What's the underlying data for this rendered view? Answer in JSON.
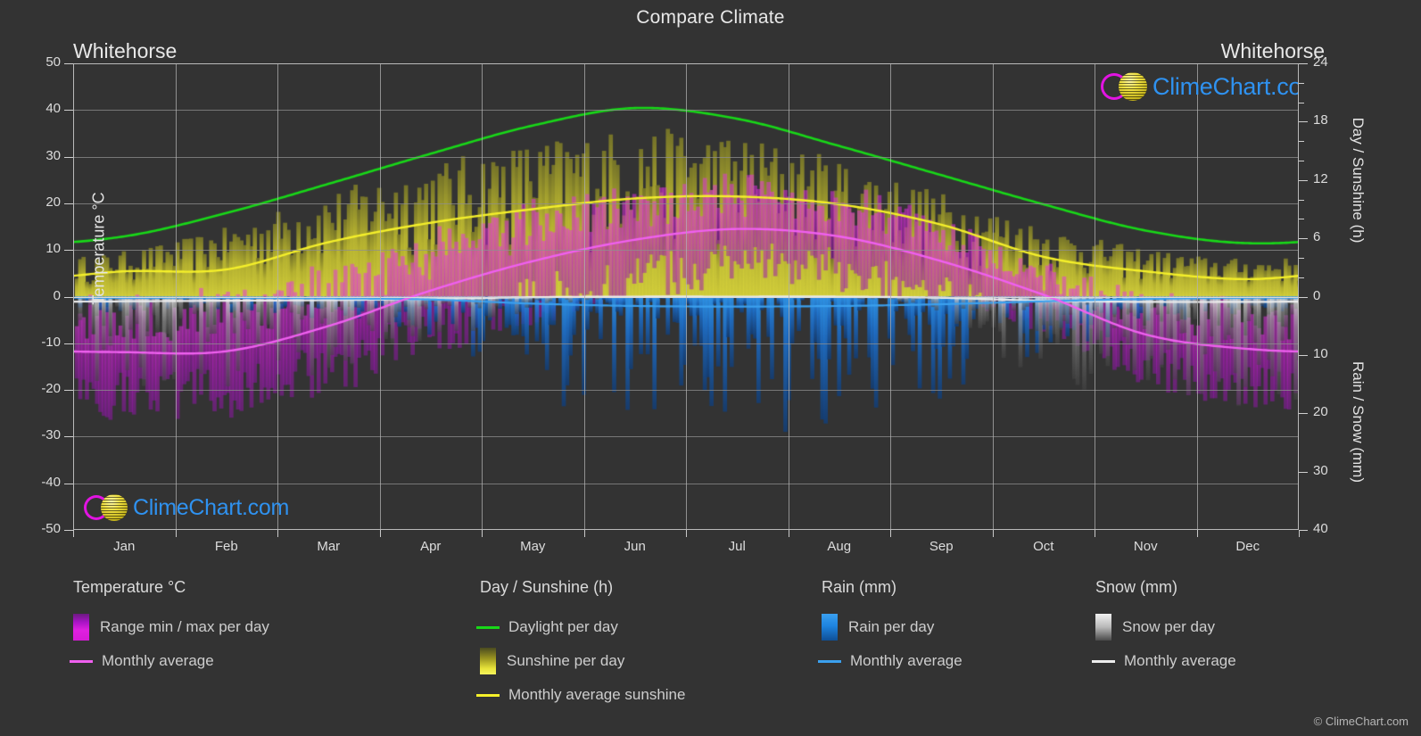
{
  "header": {
    "title": "Compare Climate",
    "location_left": "Whitehorse",
    "location_right": "Whitehorse"
  },
  "brand": {
    "name": "ClimeChart.com",
    "copyright": "© ClimeChart.com",
    "logo_arc_color": "#e214e2",
    "logo_ball_color": "#e8d81e",
    "text_color": "#2f92f0"
  },
  "axes": {
    "left_title": "Temperature °C",
    "left_ticks": [
      "50",
      "40",
      "30",
      "20",
      "10",
      "0",
      "-10",
      "-20",
      "-30",
      "-40",
      "-50"
    ],
    "right_top_title": "Day / Sunshine (h)",
    "right_top_ticks": [
      "24",
      "18",
      "12",
      "6",
      "0"
    ],
    "right_bottom_title": "Rain / Snow (mm)",
    "right_bottom_ticks": [
      "0",
      "10",
      "20",
      "30",
      "40"
    ],
    "x_ticks": [
      "Jan",
      "Feb",
      "Mar",
      "Apr",
      "May",
      "Jun",
      "Jul",
      "Aug",
      "Sep",
      "Oct",
      "Nov",
      "Dec"
    ]
  },
  "legend": {
    "groups": [
      {
        "title": "Temperature °C",
        "items": [
          {
            "label": "Range min / max per day",
            "type": "swatch",
            "color": "#e020e0"
          },
          {
            "label": "Monthly average",
            "type": "line",
            "color": "#f060f0"
          }
        ]
      },
      {
        "title": "Day / Sunshine (h)",
        "items": [
          {
            "label": "Daylight per day",
            "type": "line",
            "color": "#18d818"
          },
          {
            "label": "Sunshine per day",
            "type": "swatch",
            "color": "#f2ef3c"
          },
          {
            "label": "Monthly average sunshine",
            "type": "line",
            "color": "#f5f02a"
          }
        ]
      },
      {
        "title": "Rain (mm)",
        "items": [
          {
            "label": "Rain per day",
            "type": "swatch",
            "color": "#1878dc"
          },
          {
            "label": "Monthly average",
            "type": "line",
            "color": "#3ba0ee"
          }
        ]
      },
      {
        "title": "Snow (mm)",
        "items": [
          {
            "label": "Snow per day",
            "type": "swatch",
            "color": "#e0e0e0"
          },
          {
            "label": "Monthly average",
            "type": "line",
            "color": "#ededed"
          }
        ]
      }
    ]
  },
  "chart_data": {
    "type": "line",
    "title": "Compare Climate",
    "subtitle": "Whitehorse",
    "xlabel": "",
    "ylabel": "Temperature °C",
    "ylim": [
      -50,
      50
    ],
    "y2_top_label": "Day / Sunshine (h)",
    "y2_top_lim": [
      0,
      24
    ],
    "y2_bottom_label": "Rain / Snow (mm)",
    "y2_bottom_lim": [
      0,
      40
    ],
    "grid": true,
    "legend_position": "below",
    "categories": [
      "Jan",
      "Feb",
      "Mar",
      "Apr",
      "May",
      "Jun",
      "Jul",
      "Aug",
      "Sep",
      "Oct",
      "Nov",
      "Dec"
    ],
    "series": [
      {
        "name": "Daylight per day",
        "unit": "h",
        "axis": "right-top",
        "color": "#18d818",
        "values": [
          6.2,
          8.6,
          11.6,
          14.7,
          17.6,
          19.4,
          18.3,
          15.5,
          12.5,
          9.5,
          6.8,
          5.5
        ]
      },
      {
        "name": "Monthly average sunshine",
        "unit": "h",
        "axis": "right-top",
        "color": "#f5f02a",
        "values": [
          2.6,
          2.8,
          5.6,
          7.6,
          9.0,
          10.1,
          10.3,
          9.5,
          7.4,
          4.1,
          2.6,
          1.8
        ]
      },
      {
        "name": "Monthly average temperature",
        "unit": "°C",
        "axis": "left",
        "color": "#f060f0",
        "values": [
          -11.9,
          -11.7,
          -6.3,
          1.3,
          7.6,
          12.2,
          14.5,
          12.9,
          7.6,
          0.4,
          -8.1,
          -11.2
        ]
      },
      {
        "name": "Rain monthly average",
        "unit": "mm",
        "axis": "right-bottom",
        "color": "#3ba0ee",
        "values": [
          0.2,
          0.2,
          0.3,
          0.5,
          1.2,
          1.6,
          1.7,
          1.6,
          1.3,
          0.8,
          0.4,
          0.2
        ]
      },
      {
        "name": "Snow monthly average",
        "unit": "mm",
        "axis": "right-bottom",
        "color": "#ededed",
        "values": [
          0.8,
          0.7,
          0.6,
          0.4,
          0.1,
          0.0,
          0.0,
          0.0,
          0.2,
          0.7,
          0.9,
          0.9
        ]
      }
    ],
    "bands": [
      {
        "name": "Range min / max per day (temperature)",
        "unit": "°C",
        "axis": "left",
        "color": "#e020e0",
        "min": [
          -18.6,
          -18.1,
          -13.0,
          -5.2,
          1.4,
          6.3,
          8.9,
          7.5,
          2.6,
          -3.8,
          -13.4,
          -17.2
        ],
        "max": [
          -5.3,
          -4.6,
          0.9,
          8.0,
          14.3,
          18.6,
          20.4,
          18.7,
          12.1,
          3.6,
          -3.5,
          -5.9
        ]
      },
      {
        "name": "Sunshine per day",
        "unit": "h",
        "axis": "right-top",
        "color": "#f2ef3c",
        "min": [
          0,
          0,
          0,
          0,
          0,
          0,
          0,
          0,
          0,
          0,
          0,
          0
        ],
        "max": [
          4.6,
          7.0,
          10.5,
          13.4,
          15.6,
          16.8,
          16.2,
          13.8,
          10.4,
          7.1,
          4.8,
          3.8
        ]
      }
    ]
  }
}
